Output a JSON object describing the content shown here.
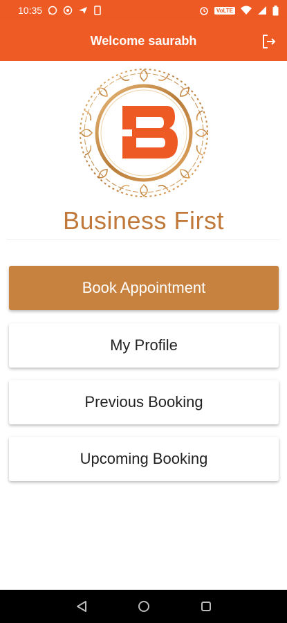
{
  "status_bar": {
    "time": "10:35",
    "network_badge": "VoLTE",
    "colors": {
      "background": "#ee5a24"
    }
  },
  "app_bar": {
    "title": "Welcome saurabh",
    "logout_icon": "logout-icon",
    "colors": {
      "background": "#ef5b25"
    }
  },
  "brand": {
    "name": "Business First",
    "logo_letter": "B",
    "colors": {
      "logo_orange": "#ee5a24",
      "gold": "#c0793b"
    }
  },
  "menu": {
    "book_appointment": "Book Appointment",
    "my_profile": "My Profile",
    "previous_booking": "Previous Booking",
    "upcoming_booking": "Upcoming Booking",
    "colors": {
      "primary": "#c8823f"
    }
  },
  "nav_bar": {
    "icons": [
      "back-icon",
      "home-icon",
      "recents-icon"
    ]
  }
}
